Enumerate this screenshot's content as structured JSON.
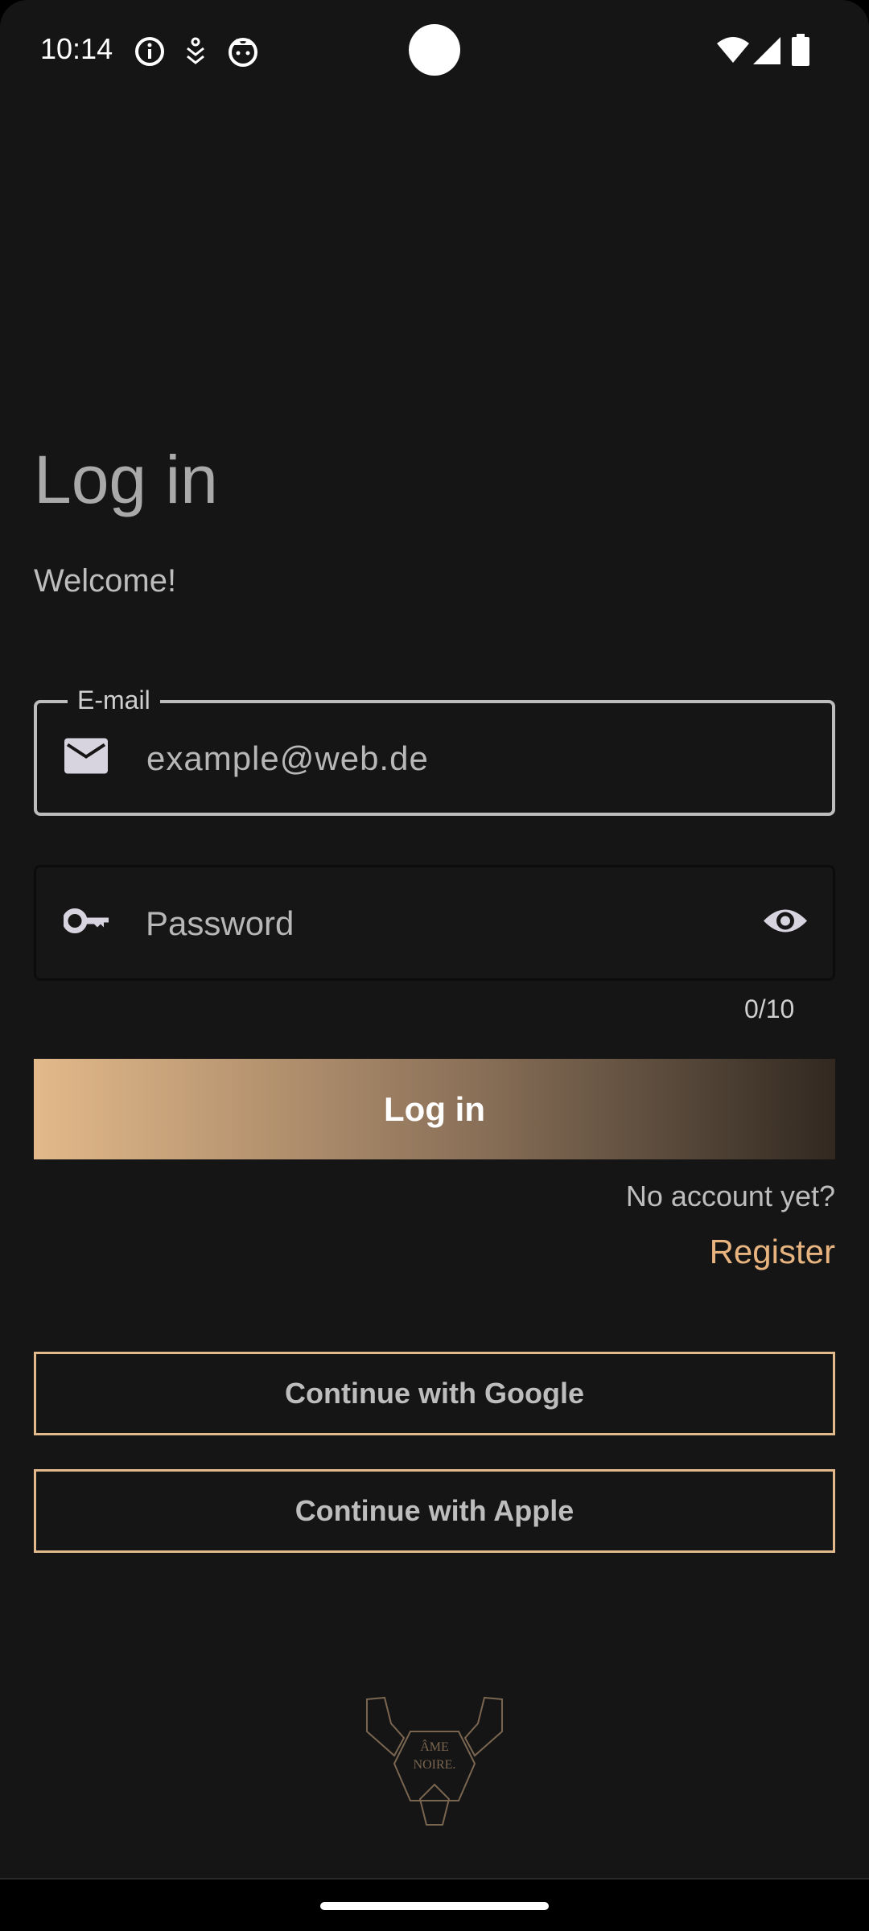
{
  "status_bar": {
    "time": "10:14",
    "icons": [
      "info-icon",
      "download-icon",
      "cat-icon",
      "wifi-icon",
      "signal-icon",
      "battery-icon"
    ]
  },
  "login": {
    "title": "Log in",
    "subtitle": "Welcome!",
    "email_label": "E-mail",
    "email_placeholder": "example@web.de",
    "password_placeholder": "Password",
    "password_counter": "0/10",
    "login_button": "Log in",
    "no_account": "No account yet?",
    "register": "Register",
    "google_button": "Continue with Google",
    "apple_button": "Continue with Apple"
  },
  "logo": {
    "text_line1": "ÂME",
    "text_line2": "NOIRE."
  },
  "colors": {
    "background": "#151515",
    "accent": "#e7b37f",
    "text": "#bdbdbd"
  }
}
